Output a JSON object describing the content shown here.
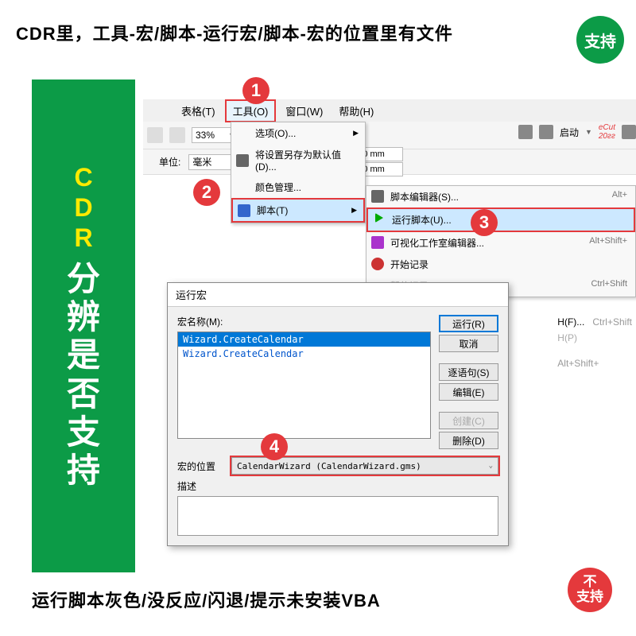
{
  "top_text": "CDR里，工具-宏/脚本-运行宏/脚本-宏的位置里有文件",
  "bottom_text": "运行脚本灰色/没反应/闪退/提示未安装VBA",
  "badge_support": "支持",
  "badge_not1": "不",
  "badge_not2": "支持",
  "banner": {
    "c": "C",
    "d": "D",
    "r": "R",
    "cn": [
      "分",
      "辨",
      "是",
      "否",
      "支",
      "持"
    ]
  },
  "markers": {
    "m1": "1",
    "m2": "2",
    "m3": "3",
    "m4": "4"
  },
  "menubar": {
    "table": "表格(T)",
    "tools": "工具(O)",
    "window": "窗口(W)",
    "help": "帮助(H)"
  },
  "toolbar": {
    "zoom": "33%",
    "launch": "启动",
    "ecut": "eCut",
    "year": "20ƨƨ"
  },
  "toolbar2": {
    "unit_lbl": "单位:",
    "unit_val": "毫米",
    "dim1": "0 mm",
    "dim2": "0 mm"
  },
  "dropdown": {
    "options": "选项(O)...",
    "save_default": "将设置另存为默认值(D)...",
    "color_mgmt": "颜色管理...",
    "scripts": "脚本(T)"
  },
  "submenu": {
    "editor": "脚本编辑器(S)...",
    "editor_sc": "Alt+",
    "run": "运行脚本(U)...",
    "vs_editor": "可视化工作室编辑器...",
    "vs_sc": "Alt+Shift+",
    "start_rec": "开始记录",
    "stop_rec": "暂停记录(A)",
    "stop_sc": "Ctrl+Shift"
  },
  "far_right": {
    "hf": "H(F)...",
    "hf_sc": "Ctrl+Shift",
    "hp": "H(P)",
    "alt": "Alt+Shift+"
  },
  "dialog": {
    "title": "运行宏",
    "macro_name_lbl": "宏名称(M):",
    "item1": "Wizard.CreateCalendar",
    "item2": "Wizard.CreateCalendar",
    "run": "运行(R)",
    "cancel": "取消",
    "step": "逐语句(S)",
    "edit": "编辑(E)",
    "create": "创建(C)",
    "delete": "删除(D)",
    "loc_lbl": "宏的位置",
    "loc_val": "CalendarWizard (CalendarWizard.gms)",
    "desc_lbl": "描述"
  }
}
